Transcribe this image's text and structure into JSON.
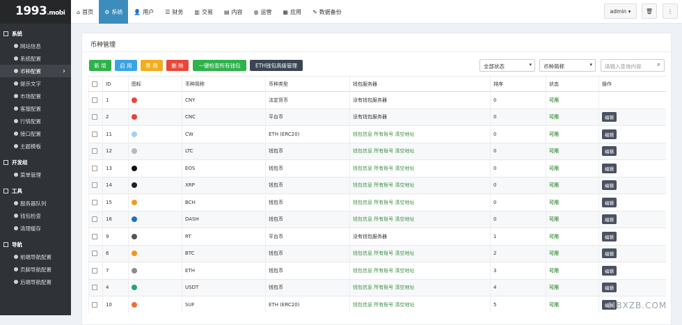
{
  "logo": {
    "main": "1993",
    "suffix": ".mobi"
  },
  "sidebar": {
    "sections": [
      {
        "label": "系统",
        "items": [
          {
            "label": "网站信息",
            "active": false
          },
          {
            "label": "系统配置",
            "active": false
          },
          {
            "label": "币种配置",
            "active": true
          },
          {
            "label": "提示文字",
            "active": false
          },
          {
            "label": "市场配置",
            "active": false
          },
          {
            "label": "客服配置",
            "active": false
          },
          {
            "label": "行情配置",
            "active": false
          },
          {
            "label": "接口配置",
            "active": false
          },
          {
            "label": "主题模板",
            "active": false
          }
        ]
      },
      {
        "label": "开发组",
        "items": [
          {
            "label": "菜单管理",
            "active": false
          }
        ]
      },
      {
        "label": "工具",
        "items": [
          {
            "label": "服务器队列",
            "active": false
          },
          {
            "label": "钱包检查",
            "active": false
          },
          {
            "label": "清理缓存",
            "active": false
          }
        ]
      },
      {
        "label": "导航",
        "items": [
          {
            "label": "前端导航配置",
            "active": false
          },
          {
            "label": "页脚导航配置",
            "active": false
          },
          {
            "label": "后端导航配置",
            "active": false
          }
        ]
      }
    ]
  },
  "topnav": [
    {
      "label": "首页",
      "icon": "home-icon",
      "glyph": "⌂"
    },
    {
      "label": "系统",
      "icon": "gear-icon",
      "glyph": "⚙",
      "active": true
    },
    {
      "label": "用户",
      "icon": "user-icon",
      "glyph": "👤"
    },
    {
      "label": "财务",
      "icon": "list-icon",
      "glyph": "☰"
    },
    {
      "label": "交易",
      "icon": "bar-chart-icon",
      "glyph": "▥"
    },
    {
      "label": "内容",
      "icon": "doc-icon",
      "glyph": "▤"
    },
    {
      "label": "运营",
      "icon": "globe-icon",
      "glyph": "◍"
    },
    {
      "label": "应用",
      "icon": "grid-icon",
      "glyph": "▦"
    },
    {
      "label": "数据备份",
      "icon": "wrench-icon",
      "glyph": "✎"
    }
  ],
  "user": {
    "name": "admin"
  },
  "panel": {
    "title": "币种管理"
  },
  "toolbar": {
    "buttons": [
      {
        "label": "新 增",
        "color": "#2eb24a"
      },
      {
        "label": "启 用",
        "color": "#3aa3e3"
      },
      {
        "label": "禁 用",
        "color": "#f0ad1e"
      },
      {
        "label": "删 除",
        "color": "#e9473a"
      },
      {
        "label": "一键检查所有钱包",
        "color": "#2eb24a"
      },
      {
        "label": "ETH钱包高级管理",
        "color": "#3a4453"
      }
    ],
    "status_select": "全部状态",
    "coin_select": "币种简称",
    "search_placeholder": "请输入查询内容"
  },
  "table": {
    "headers": [
      "ID",
      "图标",
      "币种简称",
      "币种类型",
      "钱包服务器",
      "排序",
      "状态",
      "操作"
    ],
    "rows": [
      {
        "id": "1",
        "icon_color": "#e8433b",
        "name": "CNY",
        "type": "法定货币",
        "wallet": "没有钱包服务器",
        "links": false,
        "sort": "0",
        "status": "可用",
        "edit": false
      },
      {
        "id": "2",
        "icon_color": "#e8433b",
        "name": "CNC",
        "type": "平台币",
        "wallet": "没有钱包服务器",
        "links": false,
        "sort": "0",
        "status": "可用",
        "edit": true
      },
      {
        "id": "11",
        "icon_color": "#9fd0ef",
        "name": "CW",
        "type": "ETH (ERC20)",
        "wallet": "",
        "links": true,
        "sort": "0",
        "status": "可用",
        "edit": true
      },
      {
        "id": "12",
        "icon_color": "#b8b8b8",
        "name": "LTC",
        "type": "钱包币",
        "wallet": "",
        "links": true,
        "sort": "0",
        "status": "可用",
        "edit": true
      },
      {
        "id": "13",
        "icon_color": "#111111",
        "name": "EOS",
        "type": "钱包币",
        "wallet": "",
        "links": true,
        "sort": "0",
        "status": "可用",
        "edit": true
      },
      {
        "id": "14",
        "icon_color": "#222222",
        "name": "XRP",
        "type": "钱包币",
        "wallet": "",
        "links": true,
        "sort": "0",
        "status": "可用",
        "edit": true
      },
      {
        "id": "15",
        "icon_color": "#f29a1e",
        "name": "BCH",
        "type": "钱包币",
        "wallet": "",
        "links": true,
        "sort": "0",
        "status": "可用",
        "edit": true
      },
      {
        "id": "16",
        "icon_color": "#1f6fbf",
        "name": "DASH",
        "type": "钱包币",
        "wallet": "",
        "links": true,
        "sort": "0",
        "status": "可用",
        "edit": true
      },
      {
        "id": "9",
        "icon_color": "#555555",
        "name": "RT",
        "type": "平台币",
        "wallet": "没有钱包服务器",
        "links": false,
        "sort": "1",
        "status": "可用",
        "edit": true
      },
      {
        "id": "6",
        "icon_color": "#f7931a",
        "name": "BTC",
        "type": "钱包币",
        "wallet": "",
        "links": true,
        "sort": "2",
        "status": "可用",
        "edit": true
      },
      {
        "id": "7",
        "icon_color": "#8c8c8c",
        "name": "ETH",
        "type": "钱包币",
        "wallet": "",
        "links": true,
        "sort": "3",
        "status": "可用",
        "edit": true
      },
      {
        "id": "4",
        "icon_color": "#26a17b",
        "name": "USDT",
        "type": "钱包币",
        "wallet": "",
        "links": true,
        "sort": "4",
        "status": "可用",
        "edit": true
      },
      {
        "id": "10",
        "icon_color": "#e8733b",
        "name": "SUF",
        "type": "ETH (ERC20)",
        "wallet": "",
        "links": true,
        "sort": "5",
        "status": "可用",
        "edit": true
      }
    ],
    "link_labels": [
      "钱包信息",
      "所有账号",
      "清空地址"
    ],
    "edit_label": "编辑"
  },
  "watermark": "MBXZB.COM"
}
